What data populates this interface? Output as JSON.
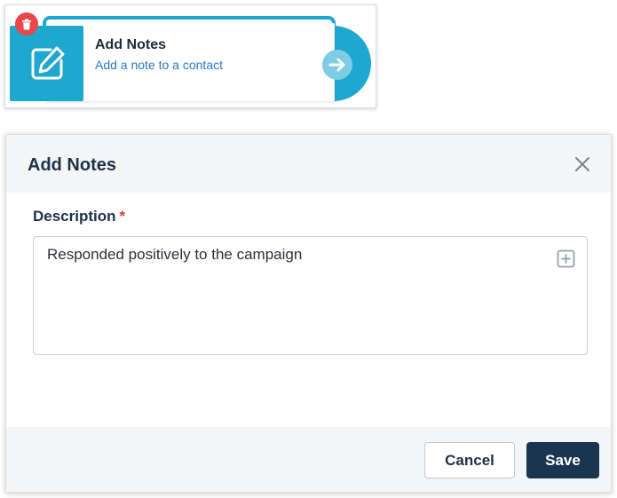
{
  "node": {
    "title": "Add Notes",
    "subtitle": "Add a note to a contact",
    "icon": "edit-note-icon",
    "delete_icon": "trash-icon",
    "next_icon": "arrow-right-icon",
    "accent_color": "#1ea7cf",
    "delete_color": "#e8484a"
  },
  "modal": {
    "title": "Add Notes",
    "close_icon": "close-icon",
    "field": {
      "label": "Description",
      "required_marker": "*",
      "value": "Responded positively to the campaign",
      "insert_icon": "plus-square-icon"
    },
    "buttons": {
      "cancel_label": "Cancel",
      "save_label": "Save"
    },
    "primary_color": "#1a3550"
  }
}
